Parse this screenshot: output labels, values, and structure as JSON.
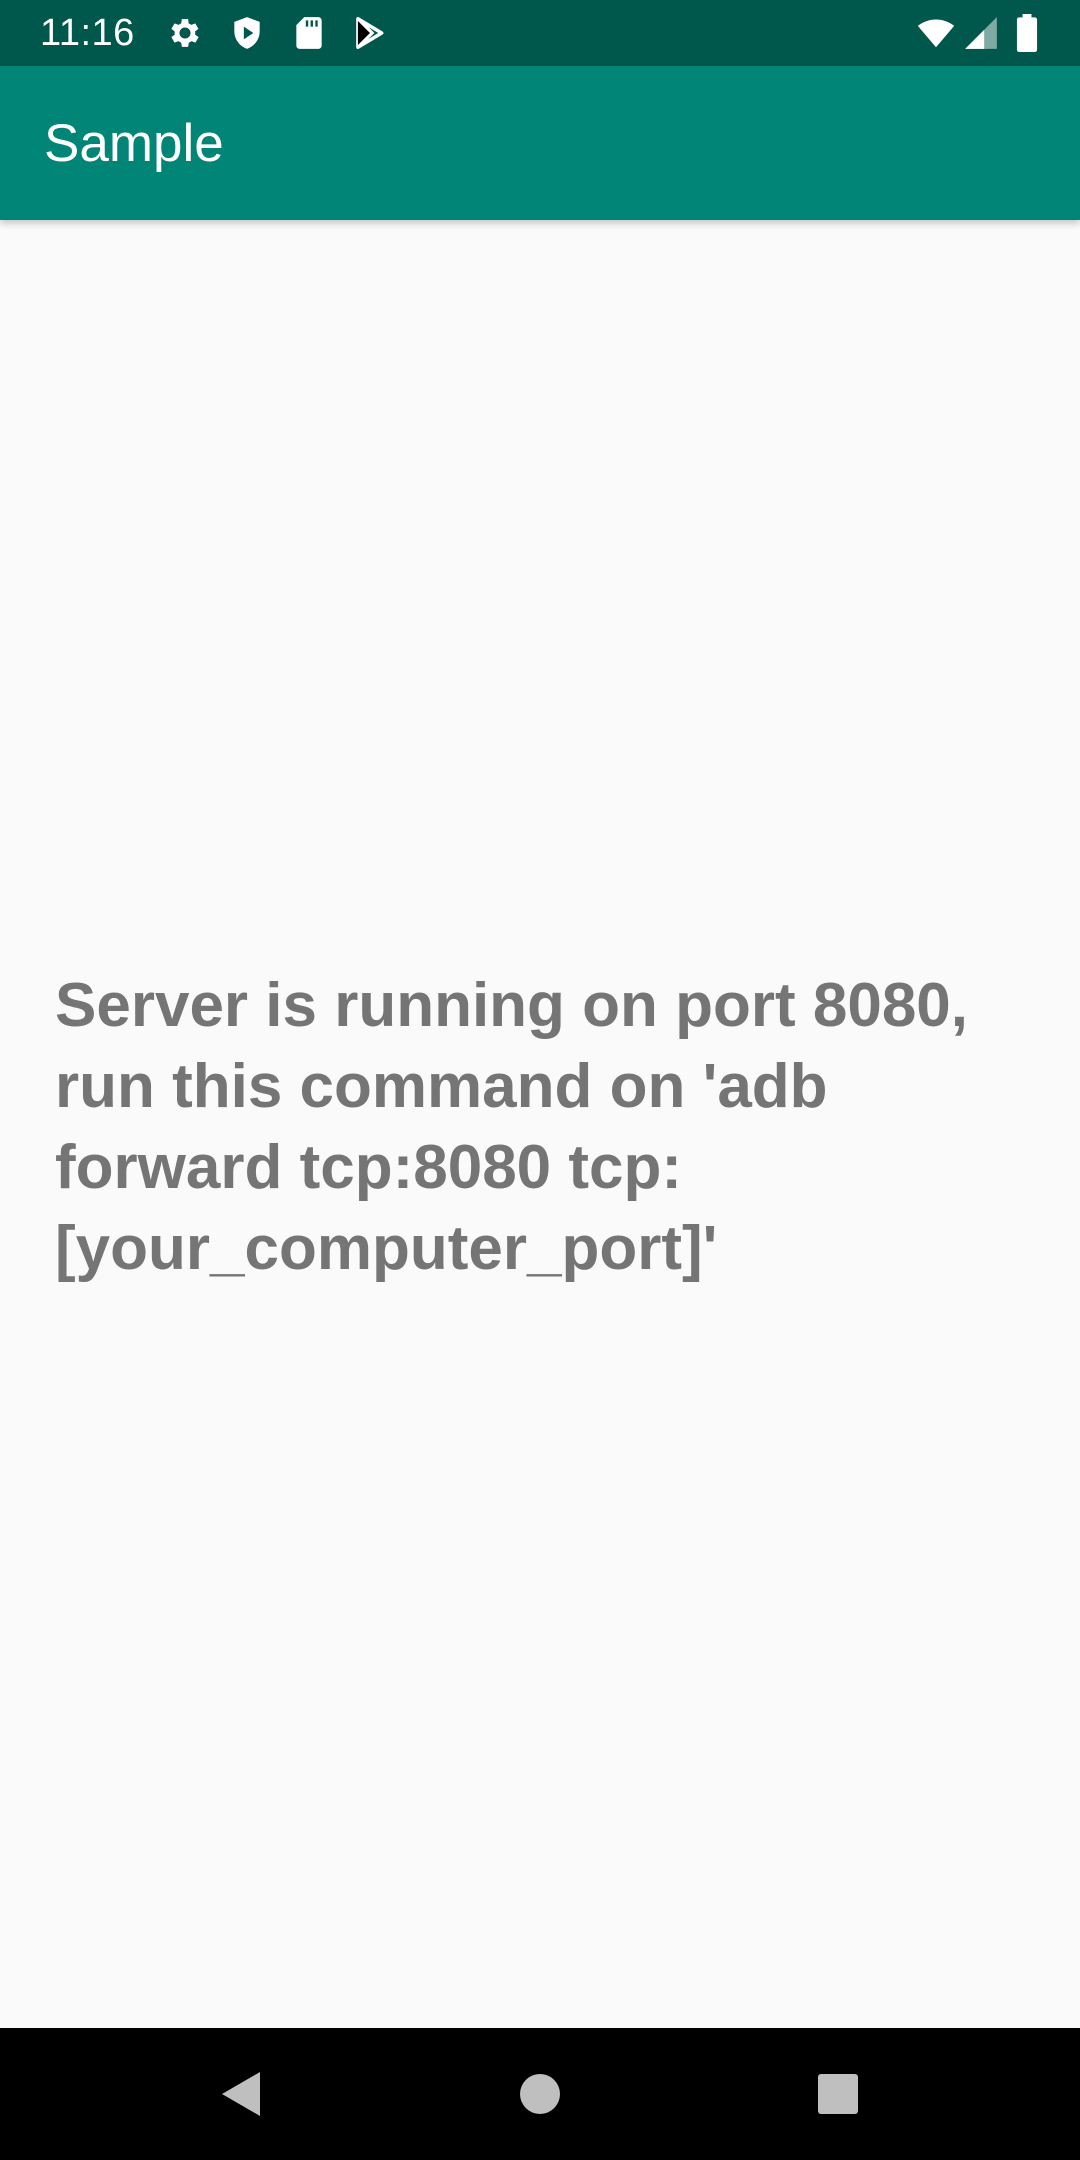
{
  "status_bar": {
    "time": "11:16",
    "icons": [
      "gear-icon",
      "shield-icon",
      "sd-card-icon",
      "play-store-icon",
      "wifi-icon",
      "signal-icon",
      "battery-icon"
    ],
    "background": "#00574b"
  },
  "app_bar": {
    "title": "Sample",
    "background": "#008577"
  },
  "content": {
    "message": "Server is running on port 8080, run this command on 'adb forward tcp:8080 tcp:[your_computer_port]'",
    "text_color": "#757575"
  },
  "nav_bar": {
    "buttons": [
      "back-icon",
      "home-icon",
      "recents-icon"
    ]
  }
}
